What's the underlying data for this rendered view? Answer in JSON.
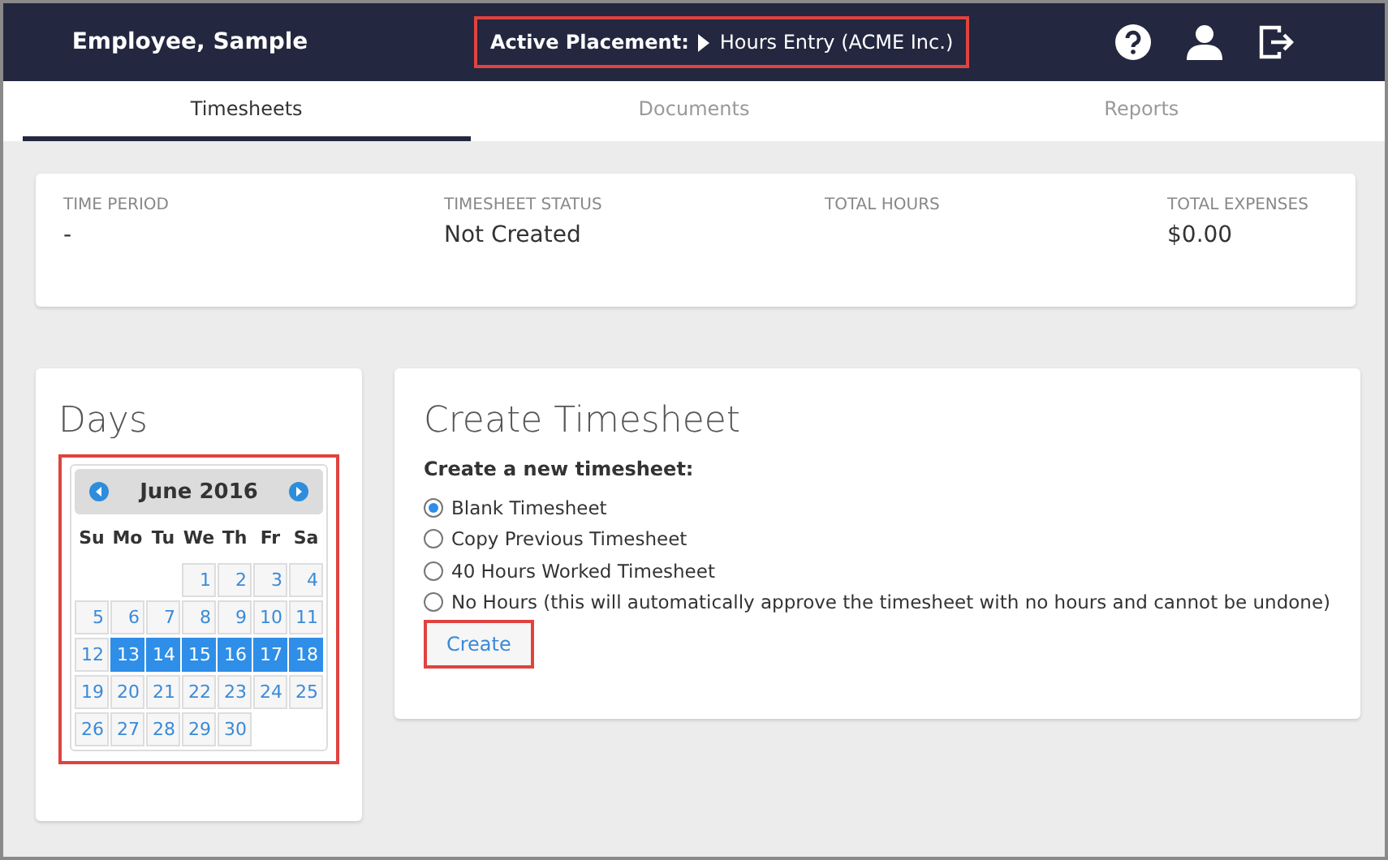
{
  "header": {
    "user": "Employee, Sample",
    "placement_label": "Active Placement:",
    "placement_value": "Hours Entry (ACME Inc.)",
    "placement_highlighted": true
  },
  "tabs": [
    {
      "label": "Timesheets",
      "selected": true
    },
    {
      "label": "Documents",
      "selected": false
    },
    {
      "label": "Reports",
      "selected": false
    }
  ],
  "summary": [
    {
      "label": "TIME PERIOD",
      "value": "-"
    },
    {
      "label": "TIMESHEET STATUS",
      "value": "Not Created"
    },
    {
      "label": "TOTAL HOURS"
    },
    {
      "label": "TOTAL EXPENSES",
      "value": "$0.00"
    }
  ],
  "days": {
    "title": "Days",
    "highlighted": true,
    "month": "June 2016",
    "weekdays": [
      "Su",
      "Mo",
      "Tu",
      "We",
      "Th",
      "Fr",
      "Sa"
    ],
    "cells": [
      {
        "kind": "blank"
      },
      {
        "kind": "blank"
      },
      {
        "kind": "blank"
      },
      {
        "kind": "day",
        "day": "1",
        "selected": false
      },
      {
        "kind": "day",
        "day": "2",
        "selected": false
      },
      {
        "kind": "day",
        "day": "3",
        "selected": false
      },
      {
        "kind": "day",
        "day": "4",
        "selected": false
      },
      {
        "kind": "day",
        "day": "5",
        "selected": false
      },
      {
        "kind": "day",
        "day": "6",
        "selected": false
      },
      {
        "kind": "day",
        "day": "7",
        "selected": false
      },
      {
        "kind": "day",
        "day": "8",
        "selected": false
      },
      {
        "kind": "day",
        "day": "9",
        "selected": false
      },
      {
        "kind": "day",
        "day": "10",
        "selected": false
      },
      {
        "kind": "day",
        "day": "11",
        "selected": false
      },
      {
        "kind": "day",
        "day": "12",
        "selected": false
      },
      {
        "kind": "day",
        "day": "13",
        "selected": true
      },
      {
        "kind": "day",
        "day": "14",
        "selected": true
      },
      {
        "kind": "day",
        "day": "15",
        "selected": true
      },
      {
        "kind": "day",
        "day": "16",
        "selected": true
      },
      {
        "kind": "day",
        "day": "17",
        "selected": true
      },
      {
        "kind": "day",
        "day": "18",
        "selected": true
      },
      {
        "kind": "day",
        "day": "19",
        "selected": false
      },
      {
        "kind": "day",
        "day": "20",
        "selected": false
      },
      {
        "kind": "day",
        "day": "21",
        "selected": false
      },
      {
        "kind": "day",
        "day": "22",
        "selected": false
      },
      {
        "kind": "day",
        "day": "23",
        "selected": false
      },
      {
        "kind": "day",
        "day": "24",
        "selected": false
      },
      {
        "kind": "day",
        "day": "25",
        "selected": false
      },
      {
        "kind": "day",
        "day": "26",
        "selected": false
      },
      {
        "kind": "day",
        "day": "27",
        "selected": false
      },
      {
        "kind": "day",
        "day": "28",
        "selected": false
      },
      {
        "kind": "day",
        "day": "29",
        "selected": false
      },
      {
        "kind": "day",
        "day": "30",
        "selected": false
      }
    ]
  },
  "create": {
    "title": "Create Timesheet",
    "prompt": "Create a new timesheet:",
    "options": [
      {
        "label": "Blank Timesheet",
        "selected": true
      },
      {
        "label": "Copy Previous Timesheet",
        "selected": false
      },
      {
        "label": "40 Hours Worked Timesheet",
        "selected": false
      },
      {
        "label": "No Hours (this will automatically approve the timesheet with no hours and cannot be undone)",
        "selected": false
      }
    ],
    "button": "Create",
    "button_highlighted": true
  }
}
